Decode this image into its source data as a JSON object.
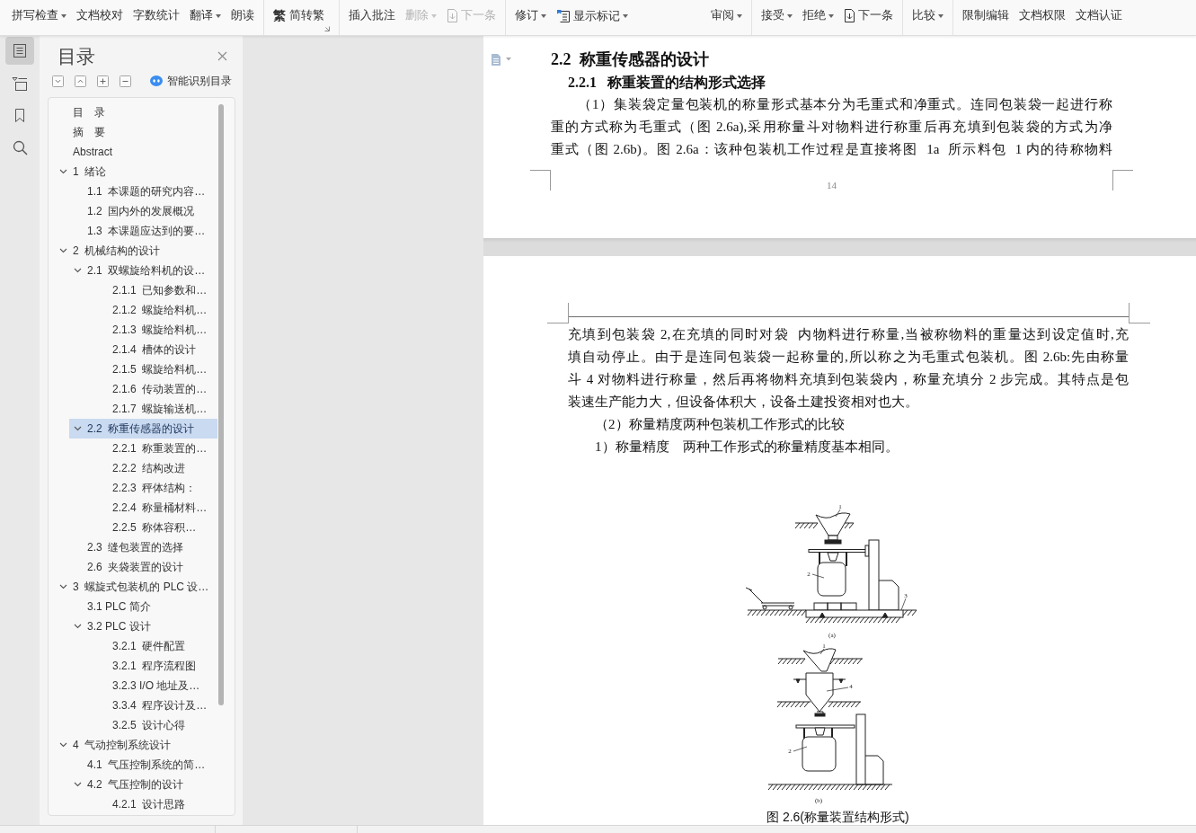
{
  "toolbar": {
    "groups": [
      {
        "items": [
          {
            "label": "拼写检查",
            "kind": "plain",
            "dropdown": true,
            "disabled": false
          },
          {
            "label": "文档校对",
            "kind": "plain",
            "dropdown": false,
            "disabled": false
          },
          {
            "label": "字数统计",
            "kind": "plain",
            "dropdown": false,
            "disabled": false
          },
          {
            "label": "翻译",
            "kind": "plain",
            "dropdown": true,
            "disabled": false
          },
          {
            "label": "朗读",
            "kind": "plain",
            "dropdown": false,
            "disabled": false
          }
        ]
      },
      {
        "launcher": true,
        "items": [
          {
            "label": "简转繁",
            "kind": "glyph",
            "glyph": "繁",
            "dropdown": false,
            "disabled": false
          }
        ]
      },
      {
        "items": [
          {
            "label": "插入批注",
            "kind": "plain",
            "dropdown": false,
            "disabled": false
          },
          {
            "label": "删除",
            "kind": "plain",
            "dropdown": true,
            "disabled": true
          },
          {
            "label": "下一条",
            "kind": "doc-arrow",
            "dropdown": false,
            "disabled": true
          }
        ]
      },
      {
        "items": [
          {
            "label": "修订",
            "kind": "plain",
            "dropdown": true,
            "disabled": false
          },
          {
            "label": "显示标记",
            "kind": "markup",
            "dropdown": true,
            "disabled": false
          },
          {
            "label": "审阅",
            "kind": "plain",
            "dropdown": true,
            "disabled": false
          }
        ]
      },
      {
        "items": [
          {
            "label": "接受",
            "kind": "plain",
            "dropdown": true,
            "disabled": false
          },
          {
            "label": "拒绝",
            "kind": "plain",
            "dropdown": true,
            "disabled": false
          },
          {
            "label": "下一条",
            "kind": "doc-arrow",
            "dropdown": false,
            "disabled": false
          }
        ]
      },
      {
        "items": [
          {
            "label": "比较",
            "kind": "plain",
            "dropdown": true,
            "disabled": false
          }
        ]
      },
      {
        "items": [
          {
            "label": "限制编辑",
            "kind": "plain",
            "dropdown": false,
            "disabled": false
          },
          {
            "label": "文档权限",
            "kind": "plain",
            "dropdown": false,
            "disabled": false
          },
          {
            "label": "文档认证",
            "kind": "plain",
            "dropdown": false,
            "disabled": false
          }
        ]
      }
    ]
  },
  "rail": [
    {
      "kind": "contents",
      "selected": true
    },
    {
      "kind": "outline",
      "selected": false
    },
    {
      "kind": "bookmarks",
      "selected": false
    },
    {
      "kind": "search",
      "selected": false
    }
  ],
  "nav": {
    "title": "目录",
    "smart_button": "智能识别目录",
    "tree": [
      {
        "label": "目　录",
        "selected": false
      },
      {
        "label": "摘　要",
        "selected": false
      },
      {
        "label": "Abstract",
        "selected": false
      },
      {
        "label": "1  绪论",
        "selected": false,
        "expanded": true,
        "children": [
          {
            "label": "1.1  本课题的研究内容…",
            "selected": false
          },
          {
            "label": "1.2  国内外的发展概况",
            "selected": false
          },
          {
            "label": "1.3  本课题应达到的要…",
            "selected": false
          }
        ]
      },
      {
        "label": "2  机械结构的设计",
        "selected": false,
        "expanded": true,
        "children": [
          {
            "label": "2.1  双螺旋给料机的设…",
            "selected": false,
            "expanded": true,
            "children": [
              {
                "label": "2.1.1  已知参数和…",
                "selected": false
              },
              {
                "label": "2.1.2  螺旋给料机…",
                "selected": false
              },
              {
                "label": "2.1.3  螺旋给料机…",
                "selected": false
              },
              {
                "label": "2.1.4  槽体的设计",
                "selected": false
              },
              {
                "label": "2.1.5  螺旋给料机…",
                "selected": false
              },
              {
                "label": "2.1.6  传动装置的…",
                "selected": false
              },
              {
                "label": "2.1.7  螺旋输送机…",
                "selected": false
              }
            ]
          },
          {
            "label": "2.2  称重传感器的设计",
            "selected": true,
            "expanded": true,
            "children": [
              {
                "label": "2.2.1  称重装置的…",
                "selected": false
              },
              {
                "label": "2.2.2  结构改进",
                "selected": false
              },
              {
                "label": "2.2.3  秤体结构：",
                "selected": false
              },
              {
                "label": "2.2.4  称量桶材料…",
                "selected": false
              },
              {
                "label": "2.2.5  称体容积…",
                "selected": false
              }
            ]
          },
          {
            "label": "2.3  缝包装置的选择",
            "selected": false
          },
          {
            "label": "2.6  夹袋装置的设计",
            "selected": false
          }
        ]
      },
      {
        "label": "3  螺旋式包装机的 PLC 设…",
        "selected": false,
        "expanded": true,
        "children": [
          {
            "label": "3.1 PLC 简介",
            "selected": false
          },
          {
            "label": "3.2 PLC 设计",
            "selected": false,
            "expanded": true,
            "children": [
              {
                "label": "3.2.1  硬件配置",
                "selected": false
              },
              {
                "label": "3.2.1  程序流程图",
                "selected": false
              },
              {
                "label": "3.2.3 I/O 地址及…",
                "selected": false
              },
              {
                "label": "3.3.4  程序设计及…",
                "selected": false
              },
              {
                "label": "3.2.5  设计心得",
                "selected": false
              }
            ]
          }
        ]
      },
      {
        "label": "4  气动控制系统设计",
        "selected": false,
        "expanded": true,
        "children": [
          {
            "label": "4.1  气压控制系统的简…",
            "selected": false
          },
          {
            "label": "4.2  气压控制的设计",
            "selected": false,
            "expanded": true,
            "children": [
              {
                "label": "4.2.1  设计思路",
                "selected": false
              }
            ]
          }
        ]
      }
    ]
  },
  "document": {
    "pages": [
      {
        "heading": "2.2  称重传感器的设计",
        "subheading": "2.2.1   称重装置的结构形式选择",
        "paragraphs": [
          {
            "runs_on": true,
            "carried_over": false,
            "lines": [
              "（1）集装袋定量包装机的称量形式基本分为毛重式和净重式。连同包装袋一起进行称",
              "重的方式称为毛重式（图 2.6a),采用称量斗对物料进行称重后再充填到包装袋的方式为净",
              "重式（图 2.6b)。图 2.6a：该种包装机工作过程是直接将图  1a  所示料包  1 内的待称物料"
            ]
          }
        ],
        "page_number": "14"
      },
      {
        "paragraphs": [
          {
            "runs_on": false,
            "carried_over": true,
            "lines": [
              "充填到包装袋 2,在充填的同时对袋  内物料进行称量,当被称物料的重量达到设定值时,充",
              "填自动停止。由于是连同包装袋一起称量的,所以称之为毛重式包装机。图 2.6b:先由称量",
              "斗 4 对物料进行称量，然后再将物料充填到包装袋内，称量充填分 2 步完成。其特点是包",
              "装速生产能力大，但设备体积大，设备土建投资相对也大。"
            ]
          },
          {
            "runs_on": false,
            "carried_over": false,
            "lines": [
              "（2）称量精度两种包装机工作形式的比较"
            ]
          },
          {
            "runs_on": false,
            "carried_over": false,
            "lines": [
              "1）称量精度　两种工作形式的称量精度基本相同。"
            ]
          }
        ],
        "figure": {
          "panels": [
            {
              "label": "(a)",
              "callouts": [
                "1",
                "2",
                "3"
              ]
            },
            {
              "label": "(b)",
              "callouts": [
                "1",
                "4",
                "2"
              ]
            }
          ],
          "caption": "图 2.6(称量装置结构形式)"
        }
      }
    ]
  }
}
